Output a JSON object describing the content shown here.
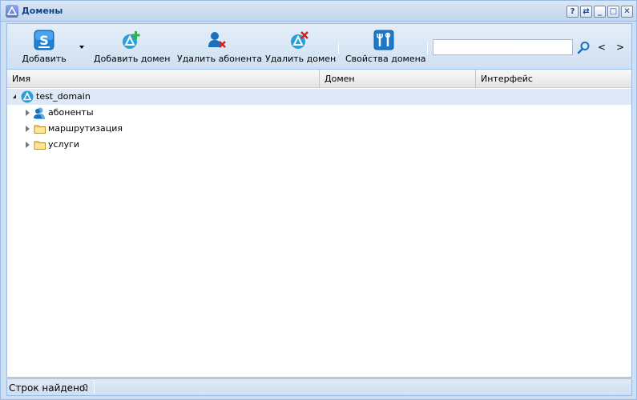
{
  "window": {
    "title": "Домены"
  },
  "title_buttons": [
    {
      "label": "?",
      "name": "help-button"
    },
    {
      "label": "⇄",
      "name": "refresh-button"
    },
    {
      "label": "_",
      "name": "minimize-button"
    },
    {
      "label": "□",
      "name": "maximize-button"
    },
    {
      "label": "✕",
      "name": "close-button"
    }
  ],
  "toolbar": {
    "add_label": "Добавить",
    "add_domain_label": "Добавить домен",
    "delete_subscriber_label": "Удалить абонента",
    "delete_domain_label": "Удалить домен",
    "domain_properties_label": "Свойства домена",
    "search_value": "",
    "prev_label": "<",
    "next_label": ">"
  },
  "grid": {
    "columns": [
      "Имя",
      "Домен",
      "Интерфейс"
    ],
    "rows": [
      {
        "label": "test_domain",
        "icon": "domain-icon",
        "expanded": true,
        "selected": true
      },
      {
        "label": "абоненты",
        "icon": "users-icon",
        "expanded": false,
        "selected": false
      },
      {
        "label": "маршрутизация",
        "icon": "folder-icon",
        "expanded": false,
        "selected": false
      },
      {
        "label": "услуги",
        "icon": "folder-icon",
        "expanded": false,
        "selected": false
      }
    ]
  },
  "status": {
    "rows_found_label": "Строк найдено:",
    "rows_found_count": "0"
  },
  "colors": {
    "title_text": "#15428b",
    "border": "#99bbe8",
    "selected_row": "#dfe8f6"
  }
}
